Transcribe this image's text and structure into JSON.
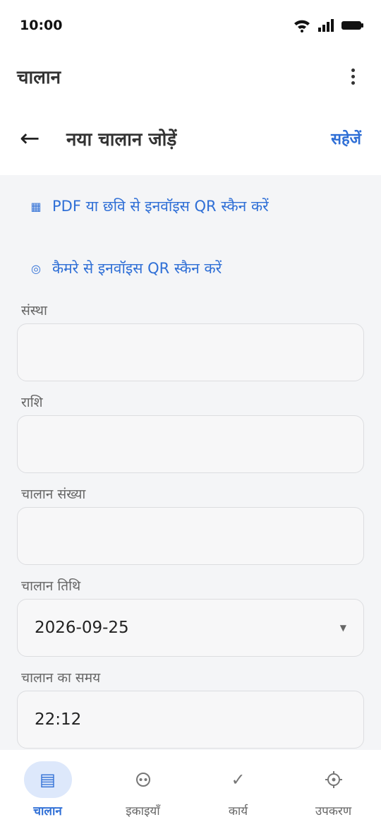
{
  "status_bar": {
    "time": "10:00"
  },
  "app_bar": {
    "title": "चालान"
  },
  "sub_header": {
    "title": "नया चालान जोड़ें",
    "save_label": "सहेजें"
  },
  "scan_options": [
    {
      "label": "PDF या छवि से इनवॉइस QR स्कैन करें",
      "icon": "qr-grid-icon"
    },
    {
      "label": "कैमरे से इनवॉइस QR स्कैन करें",
      "icon": "camera-icon"
    }
  ],
  "form": {
    "organization": {
      "label": "संस्था",
      "value": ""
    },
    "amount": {
      "label": "राशि",
      "value": ""
    },
    "invoice_number": {
      "label": "चालान संख्या",
      "value": ""
    },
    "invoice_date": {
      "label": "चालान तिथि",
      "value": "2026-09-25"
    },
    "invoice_time": {
      "label": "चालान का समय",
      "value": "22:12"
    }
  },
  "bottom_nav": [
    {
      "label": "चालान",
      "icon": "invoice-icon",
      "active": true
    },
    {
      "label": "इकाइयाँ",
      "icon": "units-icon",
      "active": false
    },
    {
      "label": "कार्य",
      "icon": "check-icon",
      "active": false
    },
    {
      "label": "उपकरण",
      "icon": "gear-icon",
      "active": false
    }
  ],
  "colors": {
    "accent": "#2f6fd6",
    "nav_active_bg": "#dde8fb",
    "background": "#f4f5f7"
  }
}
